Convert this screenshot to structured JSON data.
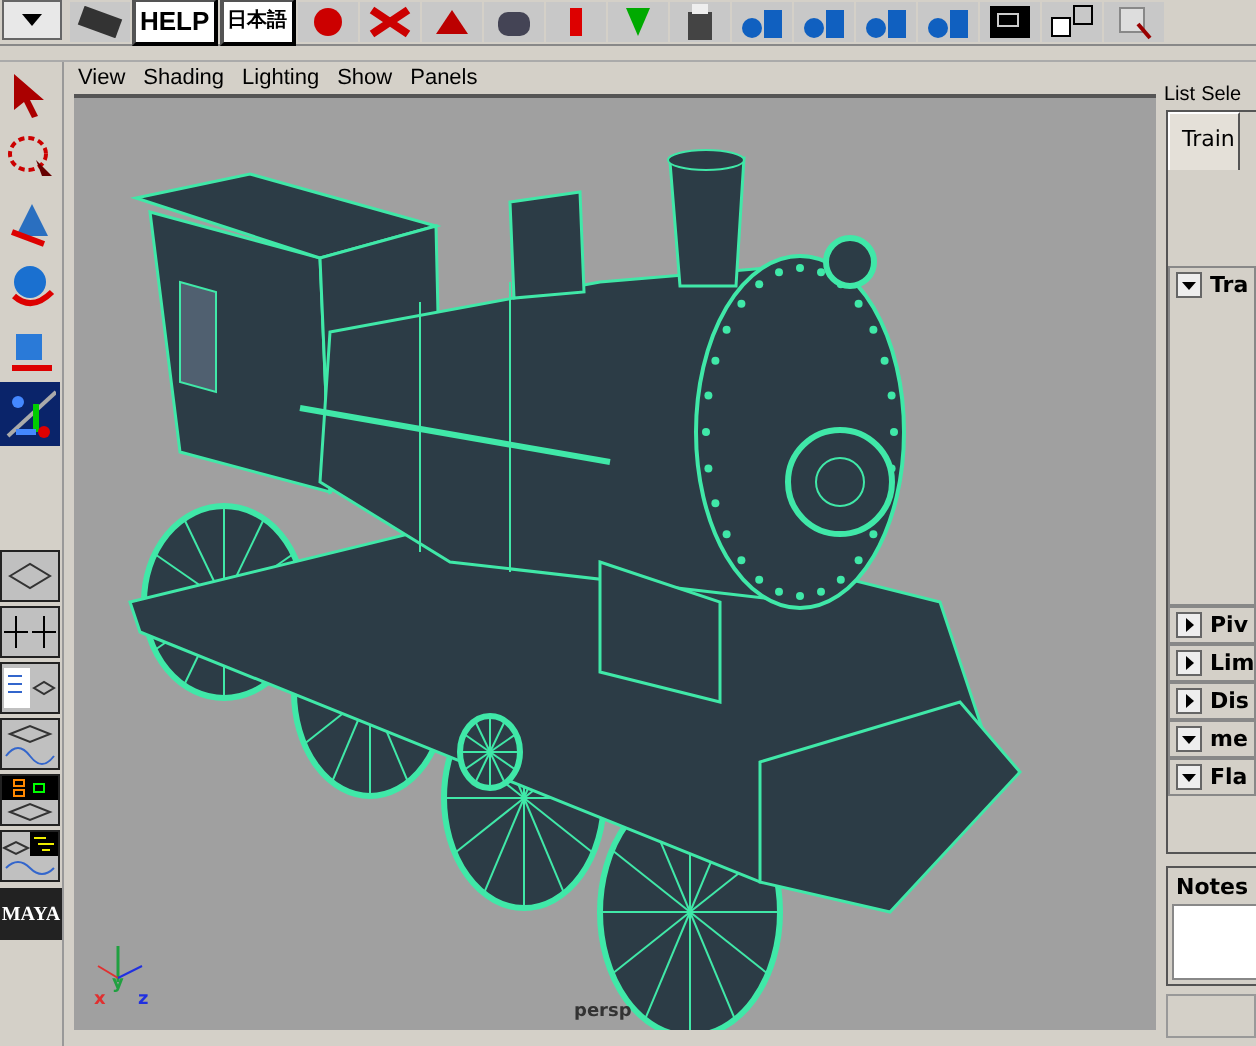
{
  "toolbar": {
    "help_label": "HELP",
    "language_label": "日本語"
  },
  "toolbox": {
    "tools": [
      {
        "kind": "select",
        "selected": false
      },
      {
        "kind": "lasso",
        "selected": false
      },
      {
        "kind": "move",
        "selected": false
      },
      {
        "kind": "rotate",
        "selected": false
      },
      {
        "kind": "scale",
        "selected": false
      },
      {
        "kind": "manipulator",
        "selected": true
      }
    ],
    "layouts": [
      {
        "kind": "single"
      },
      {
        "kind": "four"
      },
      {
        "kind": "outliner"
      },
      {
        "kind": "graph"
      },
      {
        "kind": "hypershade"
      },
      {
        "kind": "dope"
      }
    ],
    "logo": "MAYA"
  },
  "viewport": {
    "menus": [
      "View",
      "Shading",
      "Lighting",
      "Show",
      "Panels"
    ],
    "camera_label": "persp",
    "axes": [
      {
        "label": "x",
        "color": "#e03030"
      },
      {
        "label": "y",
        "color": "#20a040"
      },
      {
        "label": "z",
        "color": "#2030e0"
      }
    ]
  },
  "attribute_editor": {
    "menus": [
      "List",
      "Sele"
    ],
    "tabs": [
      {
        "label": "Train",
        "selected": true
      }
    ],
    "sections": [
      {
        "label": "Tra",
        "expanded": true
      },
      {
        "label": "Piv",
        "expanded": false
      },
      {
        "label": "Lim",
        "expanded": false
      },
      {
        "label": "Dis",
        "expanded": false
      },
      {
        "label": "me",
        "expanded": true
      },
      {
        "label": "Fla",
        "expanded": true
      }
    ],
    "notes_label": "Notes"
  }
}
